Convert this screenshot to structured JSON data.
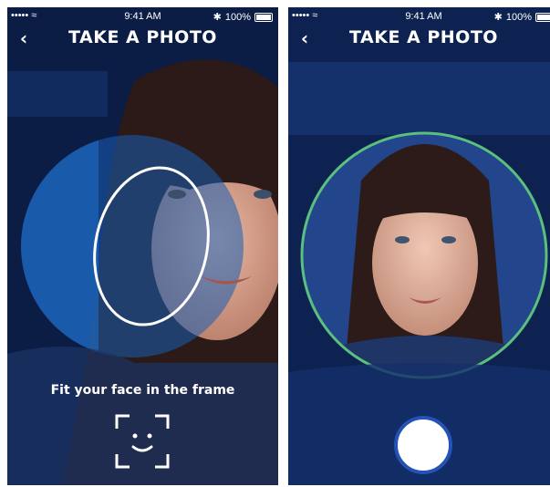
{
  "status_bar": {
    "signal": "••••• ≈",
    "time": "9:41 AM",
    "battery": "100%"
  },
  "screens": [
    {
      "back_icon": "back-chevron-icon",
      "title": "TAKE A PHOTO",
      "instruction": "Fit your face in the frame",
      "guide_icon": "face-scan-icon"
    },
    {
      "back_icon": "back-chevron-icon",
      "title": "TAKE A PHOTO",
      "capture_icon": "shutter-button-icon",
      "frame_color": "#5bbf7d"
    }
  ],
  "colors": {
    "accent_blue": "#1a5fb4",
    "ring_green": "#5bbf7d",
    "capture_border": "#2452b8"
  }
}
